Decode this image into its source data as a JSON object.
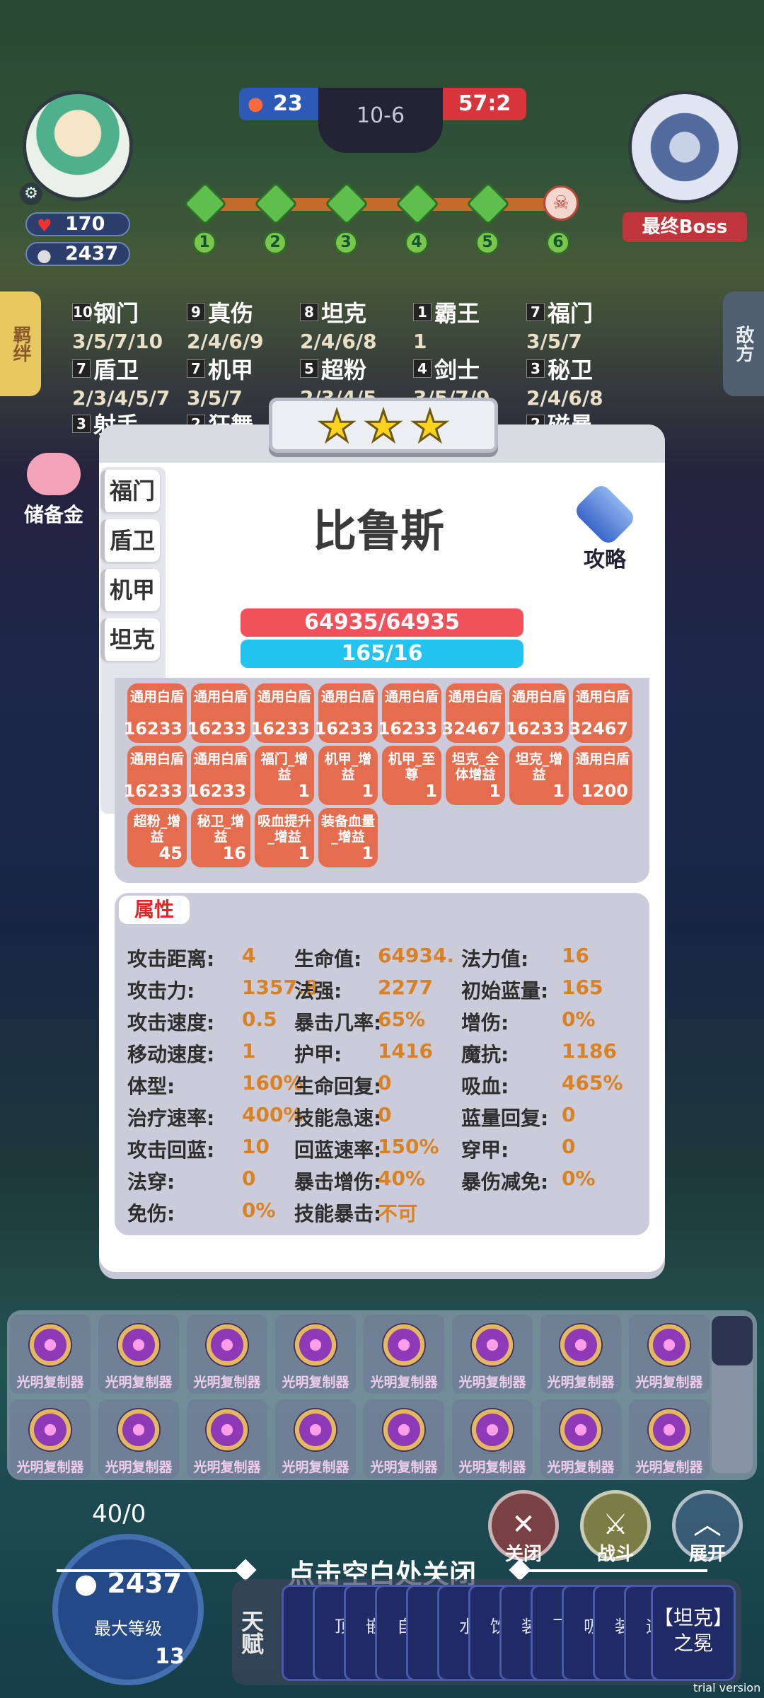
{
  "hud": {
    "player_hp": "170",
    "player_gold": "2437",
    "score_left": "23",
    "level": "10-6",
    "score_right": "57:2",
    "stages": [
      "1",
      "2",
      "3",
      "4",
      "5",
      "6"
    ],
    "boss_label": "最终Boss"
  },
  "side": {
    "left_tab": "羁绊",
    "right_tab": "敌方",
    "piggy_label": "储备金"
  },
  "synergies": [
    {
      "count": "10",
      "name": "钢门",
      "levels": "3/5/7/10"
    },
    {
      "count": "9",
      "name": "真伤",
      "levels": "2/4/6/9"
    },
    {
      "count": "8",
      "name": "坦克",
      "levels": "2/4/6/8"
    },
    {
      "count": "1",
      "name": "霸王",
      "levels": "1"
    },
    {
      "count": "7",
      "name": "福门",
      "levels": "3/5/7"
    },
    {
      "count": "7",
      "name": "盾卫",
      "levels": "2/3/4/5/7"
    },
    {
      "count": "7",
      "name": "机甲",
      "levels": "3/5/7"
    },
    {
      "count": "5",
      "name": "超粉",
      "levels": "2/3/4/5"
    },
    {
      "count": "4",
      "name": "剑士",
      "levels": "3/5/7/9"
    },
    {
      "count": "3",
      "name": "秘卫",
      "levels": "2/4/6/8"
    },
    {
      "count": "3",
      "name": "射手",
      "levels": ""
    },
    {
      "count": "2",
      "name": "狂舞",
      "levels": ""
    },
    {
      "count": "2",
      "name": "磁暴",
      "levels": ""
    }
  ],
  "card": {
    "stars": 3,
    "hero_name": "比鲁斯",
    "guide_label": "攻略",
    "tags": [
      "福门",
      "盾卫",
      "机甲",
      "坦克"
    ],
    "hp_text": "64935/64935",
    "mp_text": "165/16",
    "buffs": [
      {
        "name": "通用白盾",
        "value": "16233"
      },
      {
        "name": "通用白盾",
        "value": "16233"
      },
      {
        "name": "通用白盾",
        "value": "16233"
      },
      {
        "name": "通用白盾",
        "value": "16233"
      },
      {
        "name": "通用白盾",
        "value": "16233"
      },
      {
        "name": "通用白盾",
        "value": "32467"
      },
      {
        "name": "通用白盾",
        "value": "16233"
      },
      {
        "name": "通用白盾",
        "value": "32467"
      },
      {
        "name": "通用白盾",
        "value": "16233"
      },
      {
        "name": "通用白盾",
        "value": "16233"
      },
      {
        "name": "福门_增益",
        "value": "1"
      },
      {
        "name": "机甲_增益",
        "value": "1"
      },
      {
        "name": "机甲_至尊",
        "value": "1"
      },
      {
        "name": "坦克_全体增益",
        "value": "1"
      },
      {
        "name": "坦克_增益",
        "value": "1"
      },
      {
        "name": "通用白盾",
        "value": "1200"
      },
      {
        "name": "超粉_增益",
        "value": "45"
      },
      {
        "name": "秘卫_增益",
        "value": "16"
      },
      {
        "name": "吸血提升_增益",
        "value": "1"
      },
      {
        "name": "装备血量_增益",
        "value": "1"
      }
    ],
    "attr_title": "属性",
    "attributes": [
      {
        "label": "攻击距离:",
        "value": "4"
      },
      {
        "label": "生命值:",
        "value": "64934."
      },
      {
        "label": "法力值:",
        "value": "16"
      },
      {
        "label": "攻击力:",
        "value": "1357.8"
      },
      {
        "label": "法强:",
        "value": "2277"
      },
      {
        "label": "初始蓝量:",
        "value": "165"
      },
      {
        "label": "攻击速度:",
        "value": "0.5"
      },
      {
        "label": "暴击几率:",
        "value": "65%"
      },
      {
        "label": "增伤:",
        "value": "0%"
      },
      {
        "label": "移动速度:",
        "value": "1"
      },
      {
        "label": "护甲:",
        "value": "1416"
      },
      {
        "label": "魔抗:",
        "value": "1186"
      },
      {
        "label": "体型:",
        "value": "160%"
      },
      {
        "label": "生命回复:",
        "value": "0"
      },
      {
        "label": "吸血:",
        "value": "465%"
      },
      {
        "label": "治疗速率:",
        "value": "400%"
      },
      {
        "label": "技能急速:",
        "value": "0"
      },
      {
        "label": "蓝量回复:",
        "value": "0"
      },
      {
        "label": "攻击回蓝:",
        "value": "10"
      },
      {
        "label": "回蓝速率:",
        "value": "150%"
      },
      {
        "label": "穿甲:",
        "value": "0"
      },
      {
        "label": "法穿:",
        "value": "0"
      },
      {
        "label": "暴击增伤:",
        "value": "40%"
      },
      {
        "label": "暴伤减免:",
        "value": "0%"
      },
      {
        "label": "免伤:",
        "value": "0%"
      },
      {
        "label": "技能暴击:",
        "value": "不可"
      }
    ]
  },
  "inventory": {
    "item_label": "光明复制器",
    "count": 16
  },
  "bottom": {
    "hint": "点击空白处关闭",
    "close_label": "关闭",
    "fight_label": "战斗",
    "expand_label": "展开",
    "level_count": "40/0",
    "gold": "2437",
    "level_label": "最大等级",
    "level_badge": "13",
    "talent_tab": "天赋",
    "talent_cards": [
      "【",
      "顶",
      "嵌",
      "自",
      "【",
      "水",
      "饮",
      "装",
      "飞",
      "吸",
      "装",
      "运"
    ],
    "talent_last": "【坦克】之冕",
    "watermark": "trial version"
  }
}
